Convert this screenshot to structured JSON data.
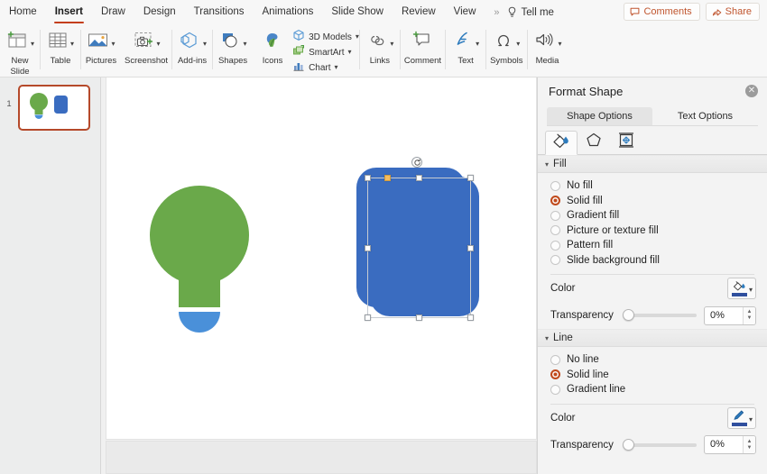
{
  "app": {
    "accent_red": "#c43e1c",
    "shape_blue": "#3a6cc0",
    "shape_green": "#6aa94a",
    "shape_light_blue": "#4a90d9"
  },
  "tabbar": {
    "tabs": [
      {
        "label": "Home",
        "active": false
      },
      {
        "label": "Insert",
        "active": true
      },
      {
        "label": "Draw",
        "active": false
      },
      {
        "label": "Design",
        "active": false
      },
      {
        "label": "Transitions",
        "active": false
      },
      {
        "label": "Animations",
        "active": false
      },
      {
        "label": "Slide Show",
        "active": false
      },
      {
        "label": "Review",
        "active": false
      },
      {
        "label": "View",
        "active": false
      }
    ],
    "overflow": "»",
    "tell_me": "Tell me",
    "comments": "Comments",
    "share": "Share"
  },
  "ribbon": {
    "groups": [
      {
        "items": [
          {
            "label": "New\nSlide",
            "label_line1": "New",
            "label_line2": "Slide",
            "icon": "new-slide-icon",
            "chevron": true
          }
        ]
      },
      {
        "items": [
          {
            "label": "Table",
            "icon": "table-icon",
            "chevron": true
          }
        ]
      },
      {
        "items": [
          {
            "label": "Pictures",
            "icon": "pictures-icon",
            "chevron": true
          },
          {
            "label": "Screenshot",
            "icon": "screenshot-icon",
            "chevron": true
          }
        ]
      },
      {
        "items": [
          {
            "label": "Add-ins",
            "icon": "addins-icon",
            "chevron": true
          }
        ]
      },
      {
        "items": [
          {
            "label": "Shapes",
            "icon": "shapes-icon",
            "chevron": true
          },
          {
            "label": "Icons",
            "icon": "icons-icon",
            "chevron": false
          }
        ],
        "stack": [
          {
            "label": "3D Models",
            "icon": "3d-models-icon",
            "chevron": true
          },
          {
            "label": "SmartArt",
            "icon": "smartart-icon",
            "chevron": true
          },
          {
            "label": "Chart",
            "icon": "chart-icon",
            "chevron": true
          }
        ]
      },
      {
        "items": [
          {
            "label": "Links",
            "icon": "links-icon",
            "chevron": true
          }
        ]
      },
      {
        "items": [
          {
            "label": "Comment",
            "icon": "comment-icon",
            "chevron": false
          }
        ]
      },
      {
        "items": [
          {
            "label": "Text",
            "icon": "text-icon",
            "chevron": true
          }
        ]
      },
      {
        "items": [
          {
            "label": "Symbols",
            "icon": "symbols-icon",
            "chevron": true
          }
        ]
      },
      {
        "items": [
          {
            "label": "Media",
            "icon": "media-icon",
            "chevron": true
          }
        ]
      }
    ]
  },
  "thumbnails": {
    "slides": [
      {
        "number": "1",
        "selected": true
      }
    ]
  },
  "canvas": {
    "shapes": [
      {
        "name": "lightbulb-shape",
        "selected": false,
        "colors": [
          "#6aa94a",
          "#4a90d9"
        ]
      },
      {
        "name": "rounded-rectangle-back",
        "selected": false,
        "color": "#3a6cc0"
      },
      {
        "name": "rounded-rectangle-front",
        "selected": true,
        "color": "#3a6cc0"
      }
    ]
  },
  "panel": {
    "title": "Format Shape",
    "close_label": "✕",
    "segments": [
      {
        "label": "Shape Options",
        "active": true
      },
      {
        "label": "Text Options",
        "active": false
      }
    ],
    "icon_tabs": [
      {
        "name": "fill-line-icon",
        "active": true
      },
      {
        "name": "effects-pentagon-icon",
        "active": false
      },
      {
        "name": "size-properties-icon",
        "active": false
      }
    ],
    "fill": {
      "header": "Fill",
      "options": [
        {
          "label": "No fill",
          "checked": false
        },
        {
          "label": "Solid fill",
          "checked": true
        },
        {
          "label": "Gradient fill",
          "checked": false
        },
        {
          "label": "Picture or texture fill",
          "checked": false
        },
        {
          "label": "Pattern fill",
          "checked": false
        },
        {
          "label": "Slide background fill",
          "checked": false
        }
      ],
      "color_label": "Color",
      "color_value": "#2f4f9e",
      "transparency_label": "Transparency",
      "transparency_value": "0%"
    },
    "line": {
      "header": "Line",
      "options": [
        {
          "label": "No line",
          "checked": false
        },
        {
          "label": "Solid line",
          "checked": true
        },
        {
          "label": "Gradient line",
          "checked": false
        }
      ],
      "color_label": "Color",
      "color_value": "#2f4f9e",
      "transparency_label": "Transparency",
      "transparency_value": "0%"
    }
  }
}
